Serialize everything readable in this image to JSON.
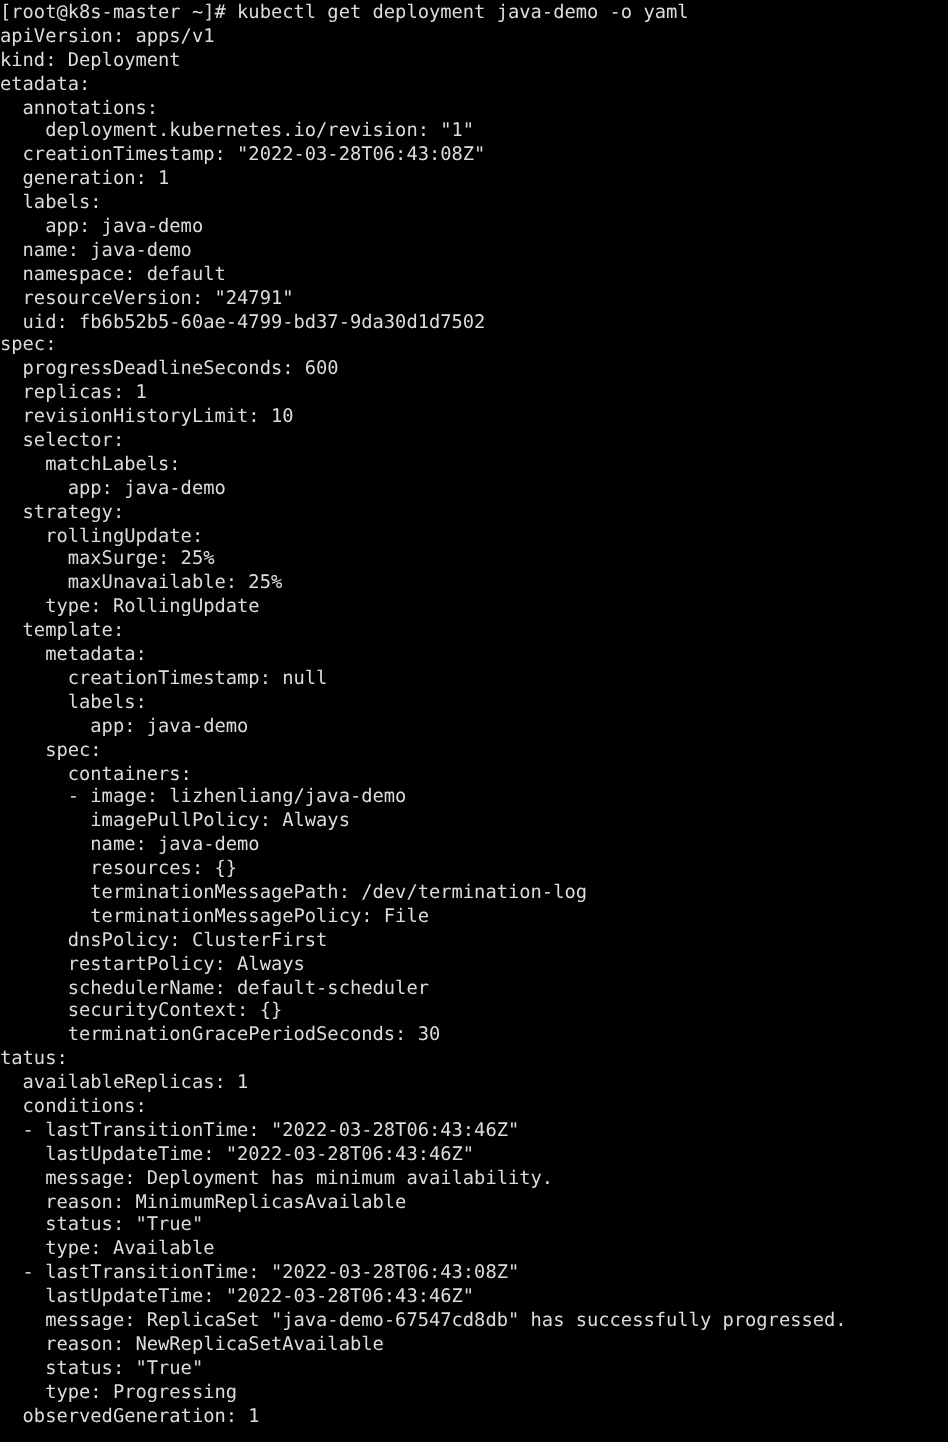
{
  "terminal": {
    "lines": [
      "[root@k8s-master ~]# kubectl get deployment java-demo -o yaml",
      "apiVersion: apps/v1",
      "kind: Deployment",
      "etadata:",
      "  annotations:",
      "    deployment.kubernetes.io/revision: \"1\"",
      "  creationTimestamp: \"2022-03-28T06:43:08Z\"",
      "  generation: 1",
      "  labels:",
      "    app: java-demo",
      "  name: java-demo",
      "  namespace: default",
      "  resourceVersion: \"24791\"",
      "  uid: fb6b52b5-60ae-4799-bd37-9da30d1d7502",
      "spec:",
      "  progressDeadlineSeconds: 600",
      "  replicas: 1",
      "  revisionHistoryLimit: 10",
      "  selector:",
      "    matchLabels:",
      "      app: java-demo",
      "  strategy:",
      "    rollingUpdate:",
      "      maxSurge: 25%",
      "      maxUnavailable: 25%",
      "    type: RollingUpdate",
      "  template:",
      "    metadata:",
      "      creationTimestamp: null",
      "      labels:",
      "        app: java-demo",
      "    spec:",
      "      containers:",
      "      - image: lizhenliang/java-demo",
      "        imagePullPolicy: Always",
      "        name: java-demo",
      "        resources: {}",
      "        terminationMessagePath: /dev/termination-log",
      "        terminationMessagePolicy: File",
      "      dnsPolicy: ClusterFirst",
      "      restartPolicy: Always",
      "      schedulerName: default-scheduler",
      "      securityContext: {}",
      "      terminationGracePeriodSeconds: 30",
      "tatus:",
      "  availableReplicas: 1",
      "  conditions:",
      "  - lastTransitionTime: \"2022-03-28T06:43:46Z\"",
      "    lastUpdateTime: \"2022-03-28T06:43:46Z\"",
      "    message: Deployment has minimum availability.",
      "    reason: MinimumReplicasAvailable",
      "    status: \"True\"",
      "    type: Available",
      "  - lastTransitionTime: \"2022-03-28T06:43:08Z\"",
      "    lastUpdateTime: \"2022-03-28T06:43:46Z\"",
      "    message: ReplicaSet \"java-demo-67547cd8db\" has successfully progressed.",
      "    reason: NewReplicaSetAvailable",
      "    status: \"True\"",
      "    type: Progressing",
      "  observedGeneration: 1"
    ]
  }
}
